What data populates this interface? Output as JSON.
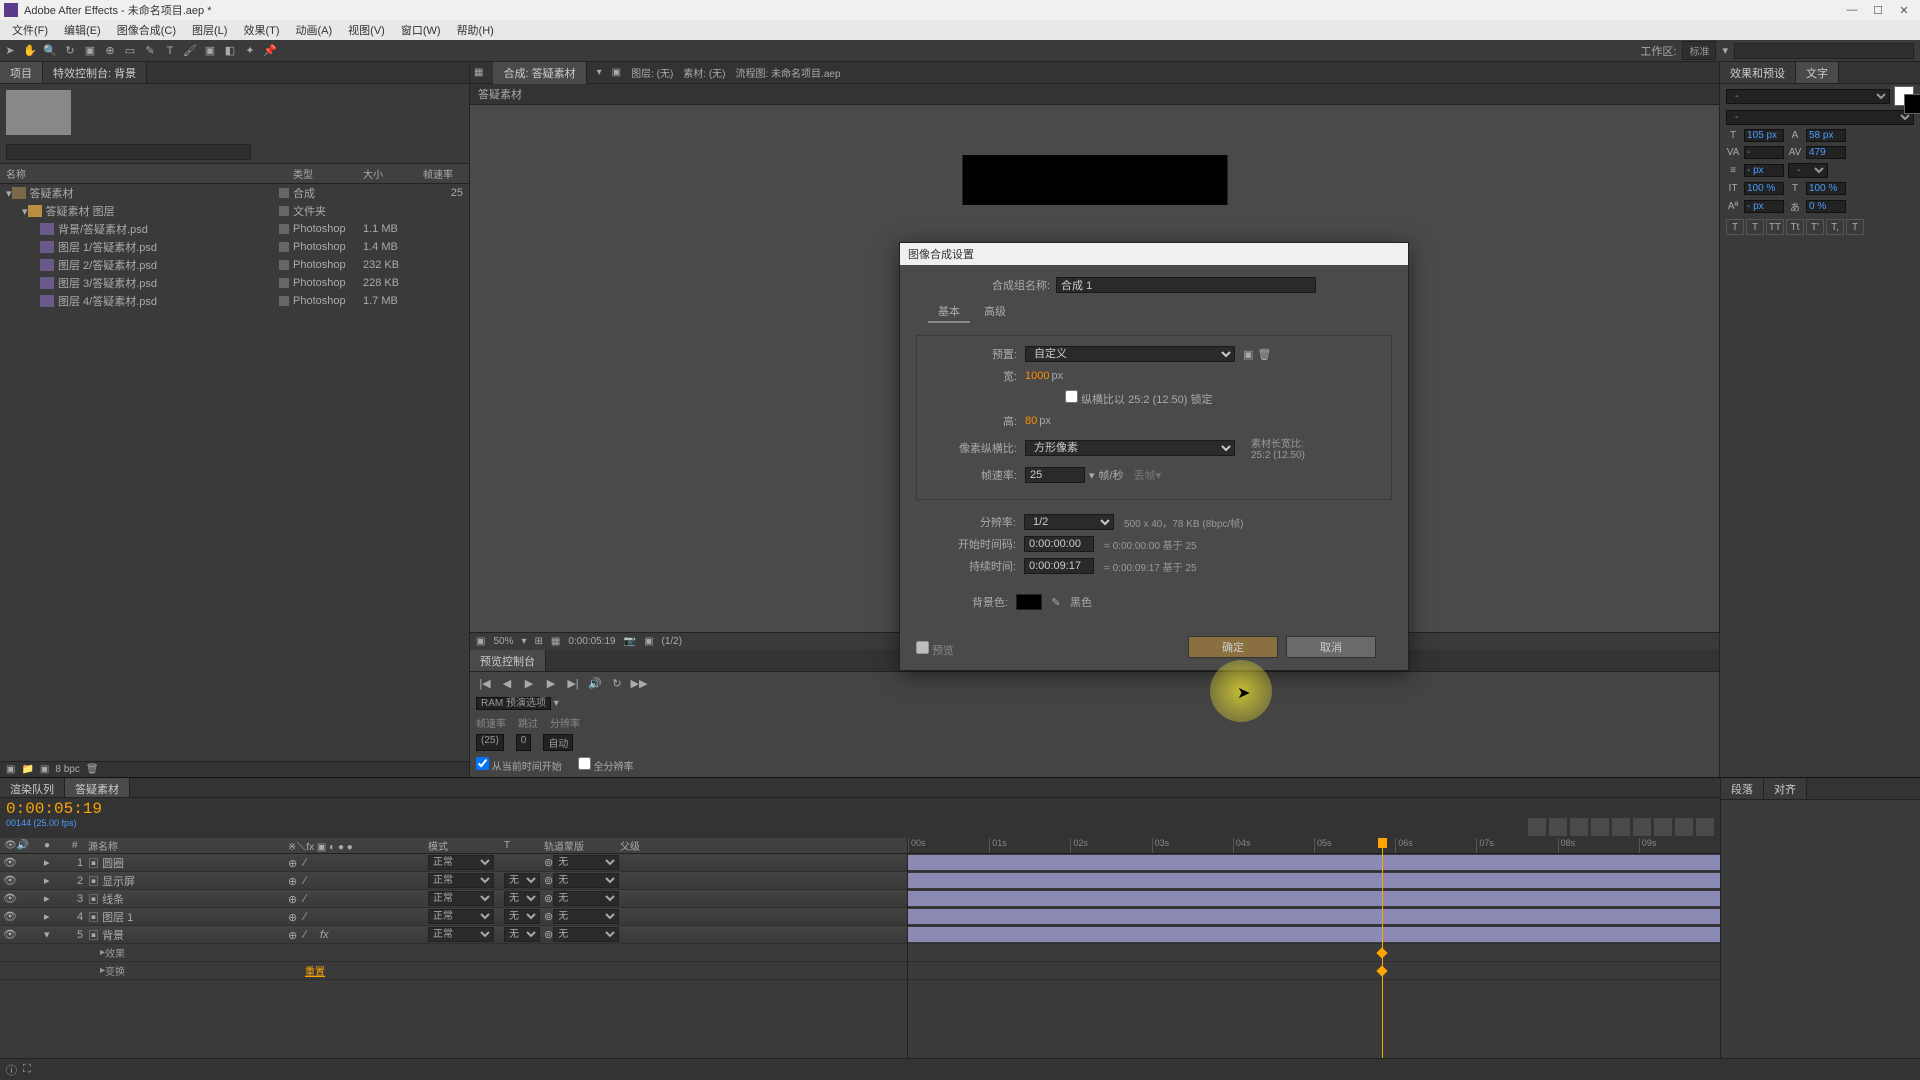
{
  "titlebar": {
    "text": "Adobe After Effects - 未命名项目.aep *"
  },
  "menu": [
    "文件(F)",
    "编辑(E)",
    "图像合成(C)",
    "图层(L)",
    "效果(T)",
    "动画(A)",
    "视图(V)",
    "窗口(W)",
    "帮助(H)"
  ],
  "workspace": {
    "label": "工作区:",
    "value": "标准"
  },
  "project": {
    "tabs": {
      "project": "项目",
      "effectControls": "特效控制台: 背景"
    },
    "cols": {
      "name": "名称",
      "type": "类型",
      "size": "大小",
      "rate": "帧速率"
    },
    "items": [
      {
        "name": "答疑素材",
        "type": "合成",
        "size": "",
        "rate": "25",
        "icon": "comp-icon",
        "indent": ""
      },
      {
        "name": "答疑素材 图层",
        "type": "文件夹",
        "size": "",
        "rate": "",
        "icon": "folder-icon",
        "indent": "indent1"
      },
      {
        "name": "背景/答疑素材.psd",
        "type": "Photoshop",
        "size": "1.1 MB",
        "rate": "",
        "icon": "file-icon",
        "indent": "indent2"
      },
      {
        "name": "图层 1/答疑素材.psd",
        "type": "Photoshop",
        "size": "1.4 MB",
        "rate": "",
        "icon": "file-icon",
        "indent": "indent2"
      },
      {
        "name": "图层 2/答疑素材.psd",
        "type": "Photoshop",
        "size": "232 KB",
        "rate": "",
        "icon": "file-icon",
        "indent": "indent2"
      },
      {
        "name": "图层 3/答疑素材.psd",
        "type": "Photoshop",
        "size": "228 KB",
        "rate": "",
        "icon": "file-icon",
        "indent": "indent2"
      },
      {
        "name": "图层 4/答疑素材.psd",
        "type": "Photoshop",
        "size": "1.7 MB",
        "rate": "",
        "icon": "file-icon",
        "indent": "indent2"
      }
    ],
    "footer": {
      "bpc": "8 bpc"
    }
  },
  "comp": {
    "tabs": {
      "comp": "合成: 答疑素材",
      "layer": "图层: (无)",
      "footage": "素材: (无)",
      "flow": "流程图: 未命名项目.aep"
    },
    "breadcrumb": "答疑素材",
    "footer": {
      "zoom": "50%",
      "time": "0:00:05:19",
      "res": "(1/2)"
    }
  },
  "preview": {
    "tab": "预览控制台",
    "ram": "RAM 预演选项",
    "labels": [
      "帧速率",
      "跳过",
      "分辨率"
    ],
    "sel": {
      "rate": "(25)",
      "skip": "0",
      "res": "自动"
    },
    "checks": {
      "fromCurrent": "从当前时间开始",
      "fullscreen": "全分辨率"
    }
  },
  "char": {
    "tabs": {
      "effects": "效果和预设",
      "char": "文字"
    },
    "fontSel": "-",
    "fontSize": "105 px",
    "leading": "58 px",
    "vscale": "-",
    "tracking": "479",
    "stroke": "- px",
    "fill": "-",
    "hscale": "100 %",
    "vscale2": "100 %",
    "baseline": "- px",
    "tsume": "0 %",
    "btns": [
      "T",
      "T",
      "TT",
      "Tt",
      "T'",
      "T,",
      "T"
    ]
  },
  "timeline": {
    "tabs": {
      "queue": "渲染队列",
      "comp": "答疑素材"
    },
    "timecode": "0:00:05:19",
    "timecodeSub": "00144 (25.00 fps)",
    "cols": {
      "source": "源名称",
      "mode": "模式",
      "trk": "轨道蒙版",
      "parent": "父级"
    },
    "layers": [
      {
        "num": "1",
        "name": "圆圈",
        "mode": "正常",
        "trk": "",
        "parent": "无"
      },
      {
        "num": "2",
        "name": "显示屏",
        "mode": "正常",
        "trk": "无",
        "parent": "无"
      },
      {
        "num": "3",
        "name": "线条",
        "mode": "正常",
        "trk": "无",
        "parent": "无"
      },
      {
        "num": "4",
        "name": "图层 1",
        "mode": "正常",
        "trk": "无",
        "parent": "无"
      },
      {
        "num": "5",
        "name": "背景",
        "mode": "正常",
        "trk": "无",
        "parent": "无"
      }
    ],
    "childRows": [
      "效果",
      "变换"
    ],
    "reset": "重置",
    "ticks": [
      "00s",
      "01s",
      "02s",
      "03s",
      "04s",
      "05s",
      "06s",
      "07s",
      "08s",
      "09s"
    ]
  },
  "bottomRight": {
    "tabs": [
      "段落",
      "对齐"
    ]
  },
  "dialog": {
    "title": "图像合成设置",
    "nameLabel": "合成组名称:",
    "nameValue": "合成 1",
    "tabs": {
      "basic": "基本",
      "advanced": "高级"
    },
    "preset": {
      "label": "预置:",
      "value": "自定义"
    },
    "width": {
      "label": "宽:",
      "value": "1000",
      "unit": "px"
    },
    "height": {
      "label": "高:",
      "value": "80",
      "unit": "px"
    },
    "lockAspect": "纵横比以 25:2 (12.50) 锁定",
    "par": {
      "label": "像素纵横比:",
      "value": "方形像素",
      "info1": "素材长宽比:",
      "info2": "25:2 (12.50)"
    },
    "fps": {
      "label": "帧速率:",
      "value": "25",
      "unit": "帧/秒",
      "drop": "丢帧"
    },
    "res": {
      "label": "分辨率:",
      "value": "1/2",
      "info": "500 x 40，78 KB (8bpc/帧)"
    },
    "start": {
      "label": "开始时间码:",
      "value": "0:00:00:00",
      "info": "= 0:00:00:00 基于 25"
    },
    "duration": {
      "label": "持续时间:",
      "value": "0:00:09:17",
      "info": "= 0:00:09:17 基于 25"
    },
    "bg": {
      "label": "背景色:",
      "color": "黑色"
    },
    "previewChk": "预览",
    "ok": "确定",
    "cancel": "取消"
  }
}
